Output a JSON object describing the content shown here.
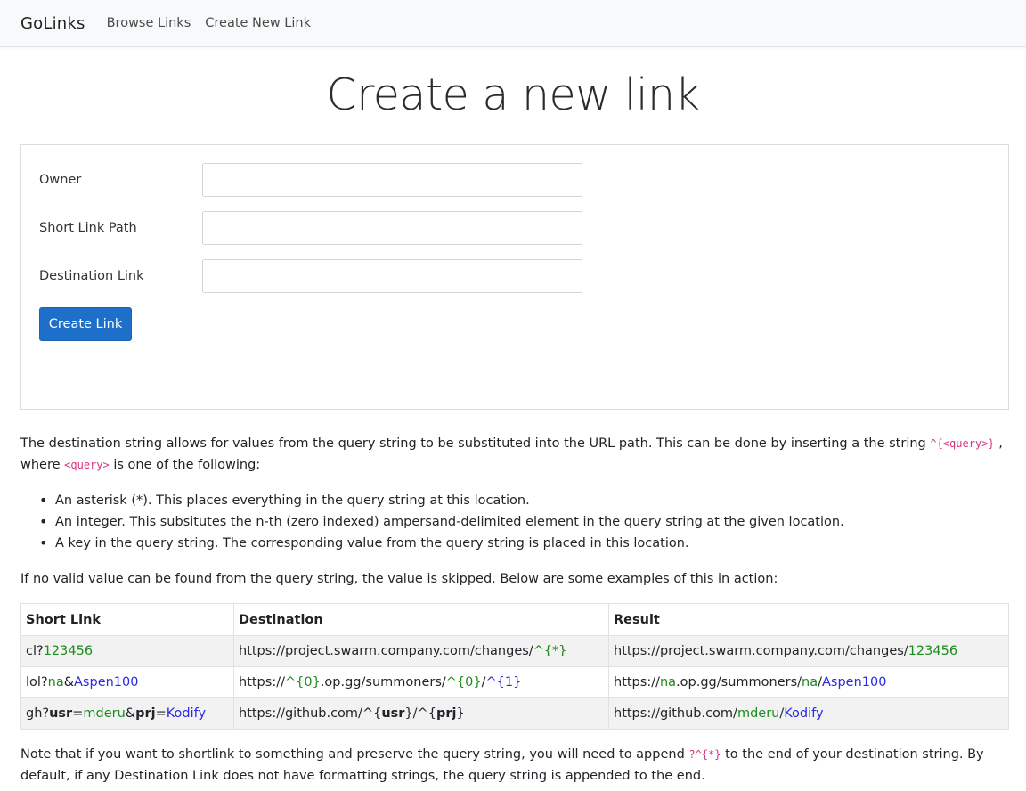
{
  "navbar": {
    "brand": "GoLinks",
    "links": [
      "Browse Links",
      "Create New Link"
    ]
  },
  "page": {
    "title": "Create a new link"
  },
  "form": {
    "owner_label": "Owner",
    "owner_value": "",
    "path_label": "Short Link Path",
    "path_value": "",
    "destination_label": "Destination Link",
    "destination_value": "",
    "submit_label": "Create Link"
  },
  "help": {
    "intro_text": "The destination string allows for values from the query string to be substituted into the URL path. This can be done by inserting a the string",
    "intro_code": "^{<query>}",
    "intro_comma": ",",
    "where_text": "where",
    "where_code": "<query>",
    "where_rest": "is one of the following:",
    "bullets": [
      "An asterisk (*). This places everything in the query string at this location.",
      "An integer. This subsitutes the n-th (zero indexed) ampersand-delimited element in the query string at the given location.",
      "A key in the query string. The corresponding value from the query string is placed in this location."
    ],
    "para2": "If no valid value can be found from the query string, the value is skipped. Below are some examples of this in action:",
    "note_before": "Note that if you want to shortlink to something and preserve the query string, you will need to append",
    "note_code": "?^{*}",
    "note_after": "to the end of your destination string. By default, if any Destination Link does not have formatting strings, the query string is appended to the end."
  },
  "table": {
    "headers": [
      "Short Link",
      "Destination",
      "Result"
    ],
    "rows": [
      {
        "short": [
          "cl?",
          "123456"
        ],
        "dest": [
          "https://project.swarm.company.com/changes/",
          "^{*}"
        ],
        "result": [
          "https://project.swarm.company.com/changes/",
          "123456"
        ]
      },
      {
        "short": [
          "lol?",
          "na",
          "&",
          "Aspen100"
        ],
        "dest": [
          "https://",
          "^{0}",
          ".op.gg/summoners/",
          "^{0}",
          "/",
          "^{1}"
        ],
        "result": [
          "https://",
          "na",
          ".op.gg/summoners/",
          "na",
          "/",
          "Aspen100"
        ]
      },
      {
        "short": [
          "gh?",
          "usr",
          "=",
          "mderu",
          "&",
          "prj",
          "=",
          "Kodify"
        ],
        "dest": [
          "https://github.com/^{",
          "usr",
          "}/^{",
          "prj",
          "}"
        ],
        "result": [
          "https://github.com/",
          "mderu",
          "/",
          "Kodify"
        ]
      }
    ]
  },
  "colors": {
    "primary": "#1e6fc9",
    "key_green": "#1c8c1c",
    "value_blue": "#2a2ae0",
    "code_pink": "#d63384"
  }
}
